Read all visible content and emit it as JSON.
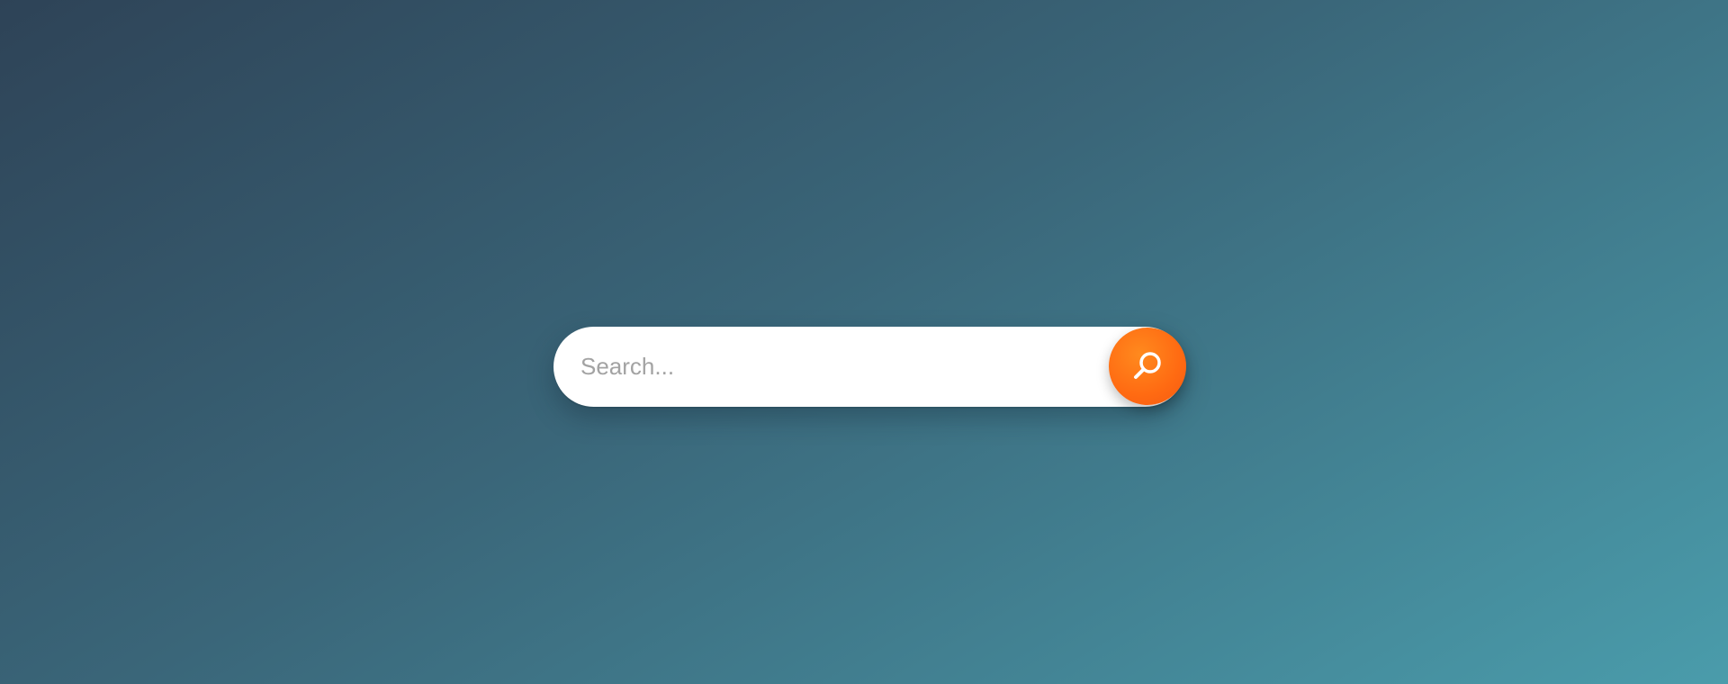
{
  "search": {
    "placeholder": "Search...",
    "value": "",
    "icon": "search-icon",
    "button_color": "#ff6a12"
  },
  "background": {
    "gradient_start": "#2e4357",
    "gradient_end": "#4a9cab"
  }
}
